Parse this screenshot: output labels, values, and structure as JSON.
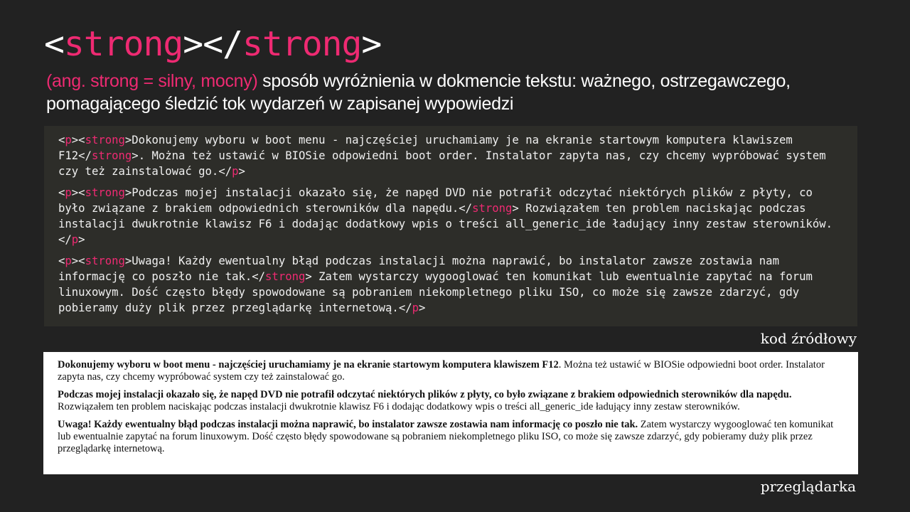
{
  "title": {
    "open_bracket": "<",
    "tag_open": "strong",
    "middle": "></",
    "tag_close": "strong",
    "close_bracket": ">"
  },
  "subtitle": {
    "highlight": "(ang. strong = silny, mocny)",
    "rest": " sposób wyróżnienia w dokmencie tekstu: ważnego, ostrzegawczego, pomagającego śledzić tok wydarzeń w zapisanej wypowiedzi"
  },
  "code": {
    "p1": {
      "t1": "<",
      "k1": "p",
      "t2": "><",
      "k2": "strong",
      "t3": ">",
      "text1": "Dokonujemy wyboru w boot menu - najczęściej uruchamiamy je na ekranie startowym komputera klawiszem F12",
      "t4": "</",
      "k3": "strong",
      "t5": ">",
      "text2": ". Można też ustawić w BIOSie odpowiedni boot order. Instalator zapyta nas, czy chcemy wypróbować system czy też zainstalować go.",
      "t6": "</",
      "k4": "p",
      "t7": ">"
    },
    "p2": {
      "t1": "<",
      "k1": "p",
      "t2": "><",
      "k2": "strong",
      "t3": ">",
      "text1": "Podczas mojej instalacji okazało się, że napęd DVD nie potrafił odczytać niektórych plików z płyty, co było związane z brakiem odpowiednich sterowników dla napędu.",
      "t4": "</",
      "k3": "strong",
      "t5": ">",
      "text2": " Rozwiązałem ten problem naciskając podczas instalacji dwukrotnie klawisz F6 i dodając dodatkowy wpis o treści all_generic_ide ładujący inny zestaw sterowników.",
      "t6": "</",
      "k4": "p",
      "t7": ">"
    },
    "p3": {
      "t1": "<",
      "k1": "p",
      "t2": "><",
      "k2": "strong",
      "t3": ">",
      "text1": "Uwaga! Każdy ewentualny błąd podczas instalacji można naprawić, bo instalator zawsze zostawia nam informację co poszło nie tak.",
      "t4": "</",
      "k3": "strong",
      "t5": ">",
      "text2": " Zatem wystarczy wygooglować ten komunikat lub ewentualnie zapytać na forum linuxowym. Dość często błędy spowodowane są pobraniem niekompletnego pliku ISO, co może się zawsze zdarzyć, gdy pobieramy duży plik przez przeglądarkę internetową.",
      "t6": "</",
      "k4": "p",
      "t7": ">"
    }
  },
  "labels": {
    "source": "kod źródłowy",
    "browser": "przeglądarka"
  },
  "browser": {
    "p1": {
      "bold": "Dokonujemy wyboru w boot menu - najczęściej uruchamiamy je na ekranie startowym komputera klawiszem F12",
      "normal": ". Można też ustawić w BIOSie odpowiedni boot order. Instalator zapyta nas, czy chcemy wypróbować system czy też zainstalować go."
    },
    "p2": {
      "bold": "Podczas mojej instalacji okazało się, że napęd DVD nie potrafił odczytać niektórych plików z płyty, co było związane z brakiem odpowiednich sterowników dla napędu.",
      "normal": " Rozwiązałem ten problem naciskając podczas instalacji dwukrotnie klawisz F6 i dodając dodatkowy wpis o treści all_generic_ide ładujący inny zestaw sterowników."
    },
    "p3": {
      "bold": "Uwaga! Każdy ewentualny błąd podczas instalacji można naprawić, bo instalator zawsze zostawia nam informację co poszło nie tak.",
      "normal": " Zatem wystarczy wygooglować ten komunikat lub ewentualnie zapytać na forum linuxowym. Dość często błędy spowodowane są pobraniem niekompletnego pliku ISO, co może się zawsze zdarzyć, gdy pobieramy duży plik przez przeglądarkę internetową."
    }
  },
  "colors": {
    "background": "#222222",
    "accent": "#ee2a72",
    "code_background": "#2d2d29",
    "browser_background": "#ffffff"
  }
}
